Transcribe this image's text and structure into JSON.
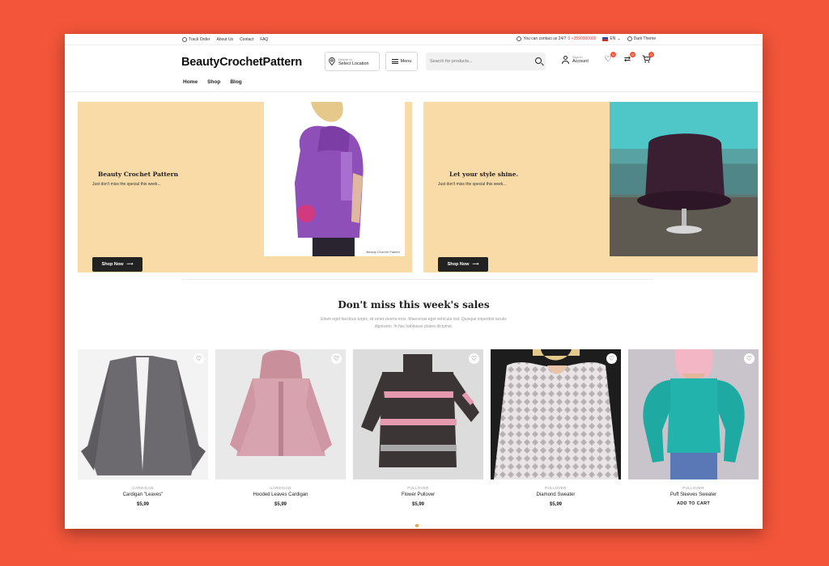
{
  "topbar": {
    "links": [
      "Track Order",
      "About Us",
      "Contact",
      "FAQ"
    ],
    "contact_text": "You can contact us 24/7",
    "phone": "0 +3590000000",
    "language": "EN",
    "theme_label": "Dark Theme"
  },
  "header": {
    "logo": "BeautyCrochetPattern",
    "location": {
      "small": "Deliver to",
      "big": "Select Location"
    },
    "menu_label": "Menu",
    "search_placeholder": "Search for products...",
    "account": {
      "small": "Sign In",
      "big": "Account"
    },
    "badges": {
      "wishlist": "0",
      "compare": "0",
      "cart": "0"
    }
  },
  "nav": {
    "items": [
      "Home",
      "Shop",
      "Blog"
    ]
  },
  "banners": [
    {
      "title": "Beauty Crochet Pattern",
      "subtitle": "Just don't miss the special this week...",
      "button": "Shop Now",
      "caption": "Beauty Crochet Pattern"
    },
    {
      "title": "Let your style shine.",
      "subtitle": "Just don't miss the special this week...",
      "button": "Shop Now"
    }
  ],
  "section": {
    "title": "Don't miss this week's sales",
    "subtitle": "Etiam eget faucibus turpis, sit amet viverra eros. Maecenas eget vehicula nisl. Quisque imperdiet iaculis dignissim. In hac habitasse platea dictumst."
  },
  "products": [
    {
      "category": "CARDIGAN",
      "name": "Cardigan \"Leaves\"",
      "price": "$5,99",
      "color": "#6c6a6e"
    },
    {
      "category": "CARDIGAN",
      "name": "Hooded Leaves Cardigan",
      "price": "$5,99",
      "color": "#d7a3ae"
    },
    {
      "category": "PULLOVER",
      "name": "Flower Pullover",
      "price": "$5,99",
      "color": "#3b3536"
    },
    {
      "category": "PULLOVER",
      "name": "Diamond Sweater",
      "price": "$5,99",
      "color": "#e9e4e6"
    },
    {
      "category": "PULLOVER",
      "name": "Puff Sleeves Sweater",
      "cta": "ADD TO CART",
      "color": "#23b3ad"
    }
  ],
  "colors": {
    "accent": "#f2553a",
    "banner_bg": "#f9dba8",
    "dark": "#222222"
  }
}
